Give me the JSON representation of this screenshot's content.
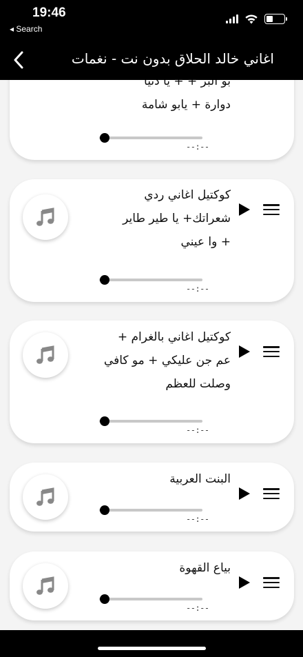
{
  "status": {
    "time": "19:46",
    "back_app": "◂ Search"
  },
  "header": {
    "title": "اغاني خالد الحلاق بدون نت - نغمات"
  },
  "songs": [
    {
      "title": "بو البر + + يا دنيا\nدوارة + يابو شامة",
      "duration": "--:--",
      "progress": 0
    },
    {
      "title": "كوكتيل اغاني ردي\nشعراتك+ يا طير طاير\n+ وا عيني",
      "duration": "--:--",
      "progress": 0
    },
    {
      "title": "كوكتيل اغاني بالغرام +\nعم جن عليكي + مو كافي\nوصلت للعظم",
      "duration": "--:--",
      "progress": 0
    },
    {
      "title": "البنت العربية",
      "duration": "--:--",
      "progress": 0
    },
    {
      "title": "بياع القهوة",
      "duration": "--:--",
      "progress": 0
    }
  ],
  "icons": {
    "artwork": "music-note-icon",
    "play": "play-icon",
    "menu": "hamburger-menu-icon",
    "back": "chevron-left-icon"
  }
}
